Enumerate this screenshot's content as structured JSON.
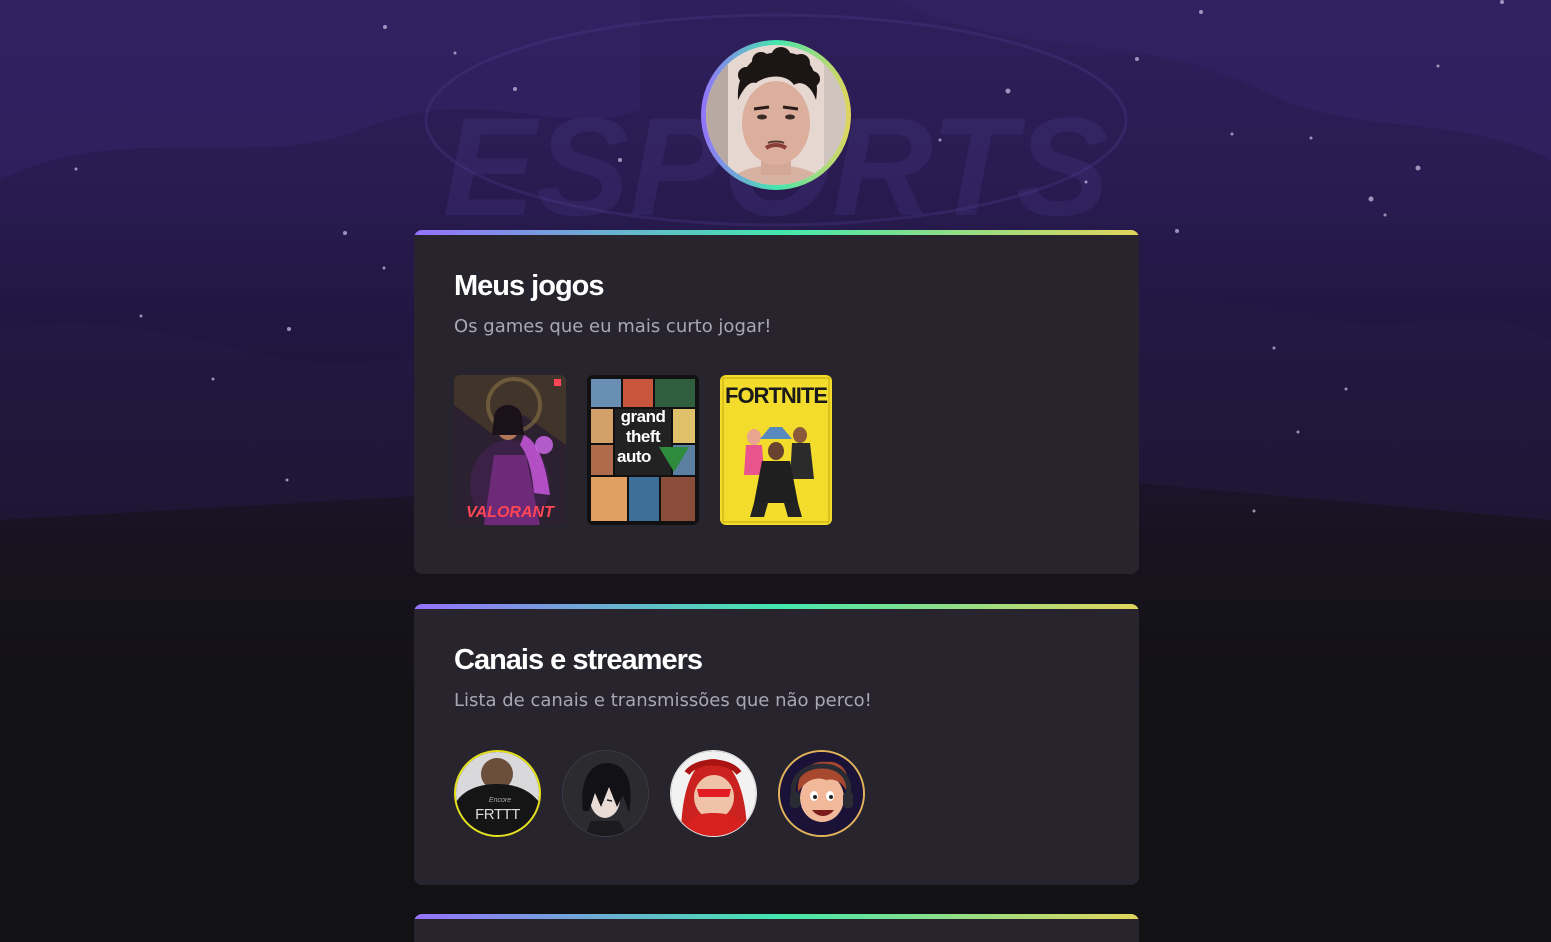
{
  "profile": {
    "avatar_alt": "profile-photo",
    "background_text": "ESPORTS"
  },
  "sections": [
    {
      "title": "Meus jogos",
      "subtitle": "Os games que eu mais curto jogar!",
      "games": [
        {
          "name": "VALORANT"
        },
        {
          "name": "GTA V",
          "cover_lines": [
            "grand",
            "theft",
            "auto"
          ]
        },
        {
          "name": "FORTNITE"
        }
      ]
    },
    {
      "title": "Canais e streamers",
      "subtitle": "Lista de canais e transmissões que não perco!",
      "channels": [
        {
          "name": "channel-1",
          "badge_text": "FRTTT"
        },
        {
          "name": "channel-2"
        },
        {
          "name": "channel-3"
        },
        {
          "name": "channel-4"
        }
      ]
    }
  ],
  "colors": {
    "gradient_start": "#9572fc",
    "gradient_mid": "#43e7ad",
    "gradient_end": "#e2d45c",
    "card_bg": "#27242e",
    "subtitle": "#a8a8b3"
  }
}
